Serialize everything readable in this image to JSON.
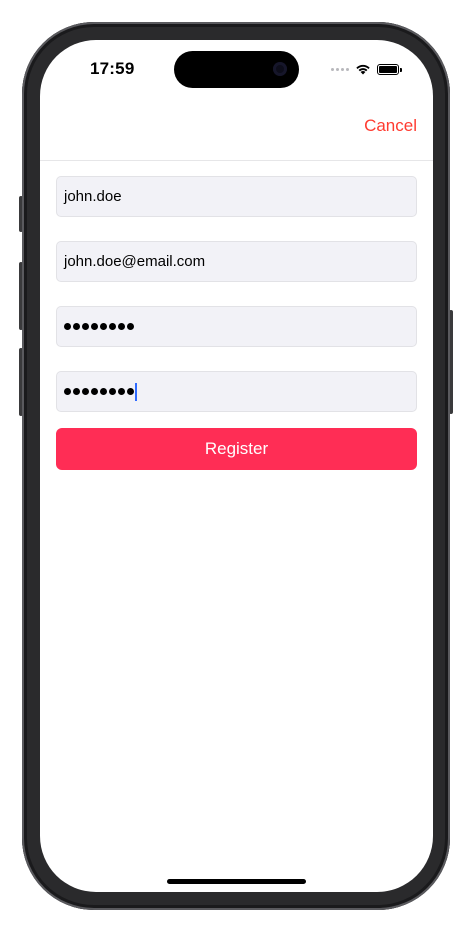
{
  "status_bar": {
    "time": "17:59",
    "icons": [
      "cellular-signal-icon",
      "wifi-icon",
      "battery-icon"
    ],
    "battery_level": 1.0
  },
  "nav": {
    "cancel_label": "Cancel"
  },
  "form": {
    "username": {
      "value": "john.doe"
    },
    "email": {
      "value": "john.doe@email.com"
    },
    "password": {
      "masked_length": 8
    },
    "confirm_password": {
      "masked_length": 8,
      "focused": true
    }
  },
  "register_label": "Register",
  "colors": {
    "accent": "#ff2d55",
    "cancel": "#ff3b30",
    "field_background": "#f2f2f7",
    "caret": "#2f6bff"
  }
}
